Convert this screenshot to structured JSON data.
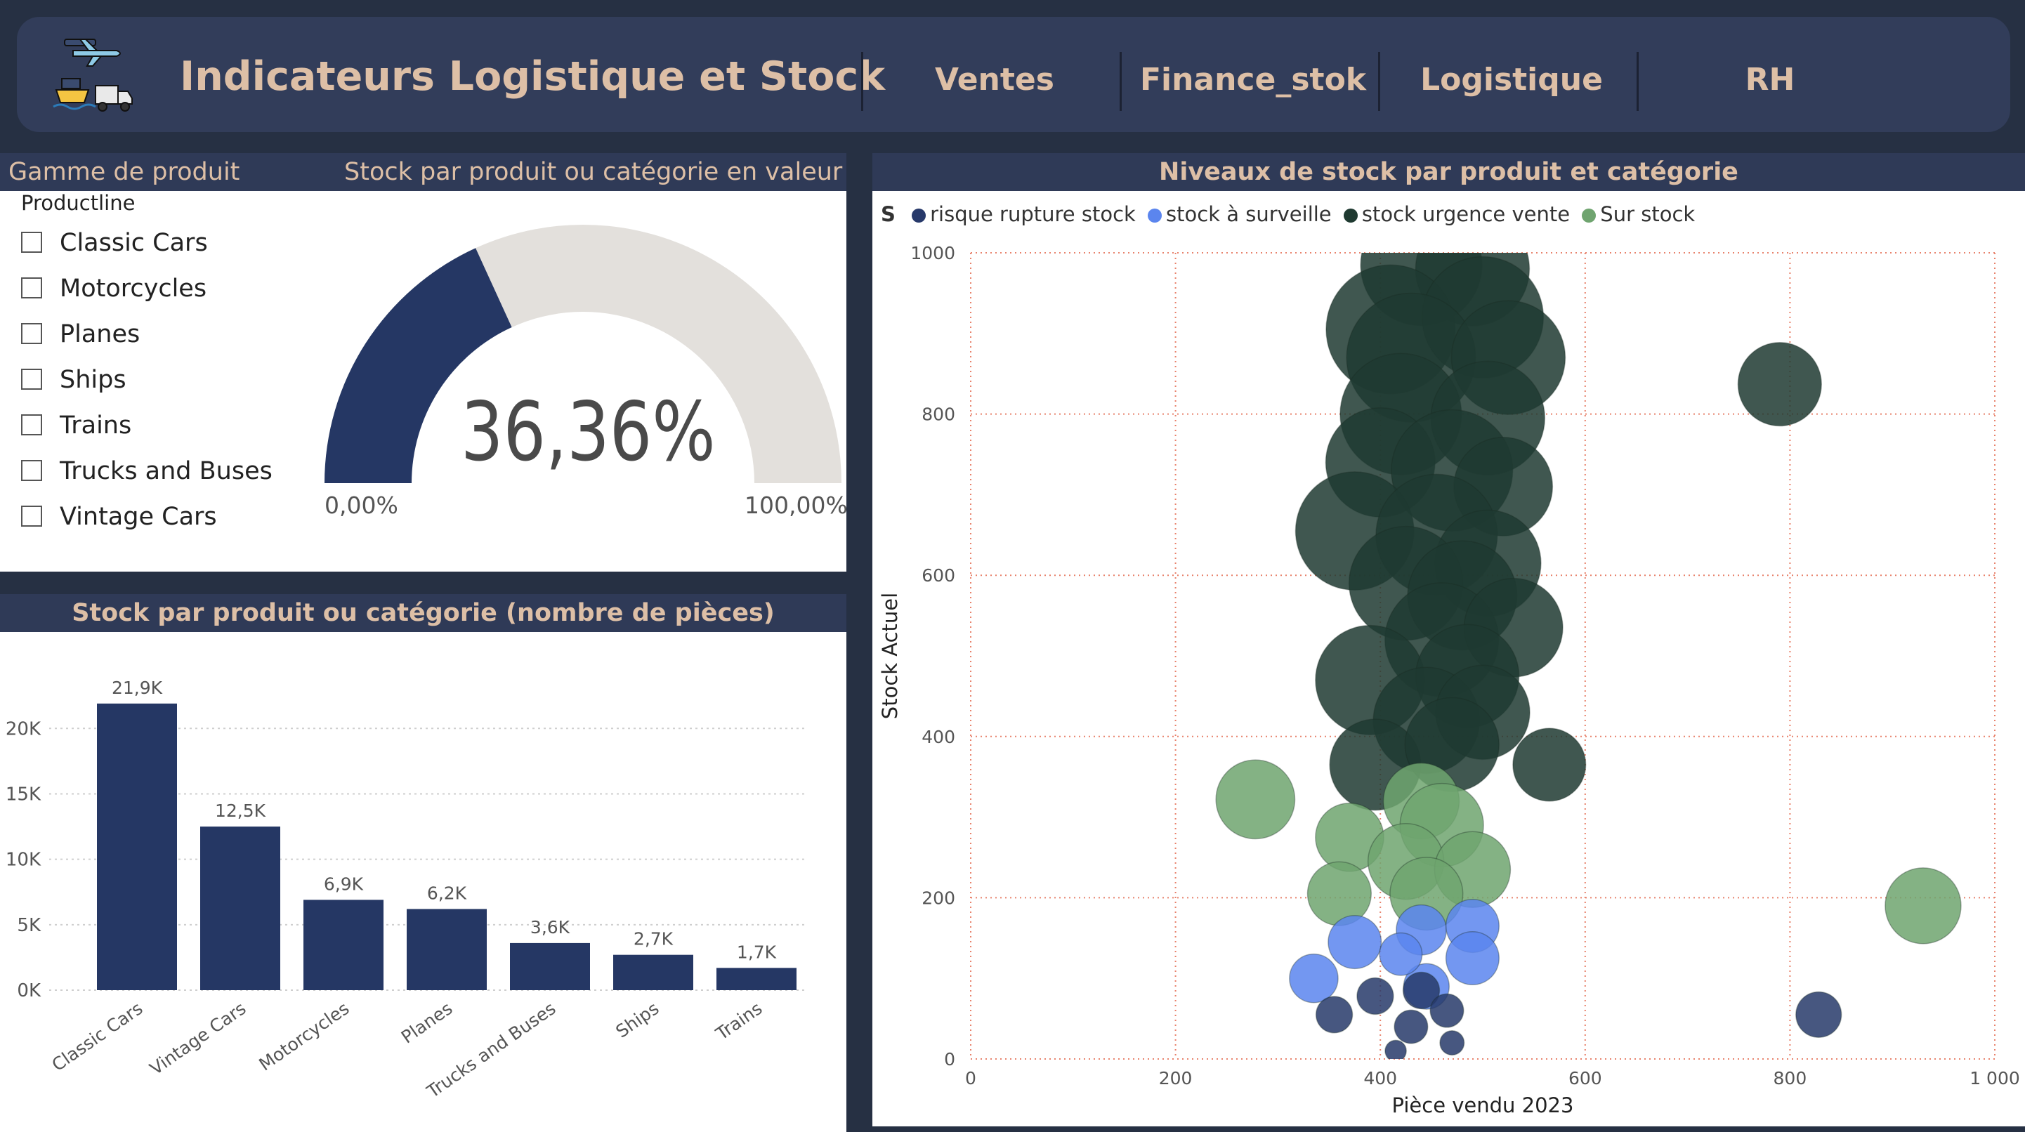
{
  "header": {
    "title": "Indicateurs Logistique et Stock",
    "nav": [
      "Ventes",
      "Finance_stok",
      "Logistique",
      "RH"
    ]
  },
  "slicer": {
    "heading": "Gamme de produit",
    "title": "Productline",
    "items": [
      "Classic Cars",
      "Motorcycles",
      "Planes",
      "Ships",
      "Trains",
      "Trucks and Buses",
      "Vintage Cars"
    ]
  },
  "gauge": {
    "heading": "Stock par produit ou catégorie en valeur",
    "value_label": "36,36%",
    "value": 36.36,
    "min_label": "0,00%",
    "max_label": "100,00%",
    "fill_color": "#253764",
    "track_color": "#e3e0dc"
  },
  "bar_chart": {
    "heading": "Stock par produit ou catégorie (nombre de pièces)"
  },
  "scatter": {
    "heading": "Niveaux de stock par produit et catégorie",
    "legend_title": "S",
    "legend": [
      {
        "label": "risque rupture stock",
        "color": "#27396a"
      },
      {
        "label": "stock à surveille",
        "color": "#5b85ee"
      },
      {
        "label": "stock urgence vente",
        "color": "#1f3a31"
      },
      {
        "label": "Sur stock",
        "color": "#6fa46f"
      }
    ]
  },
  "chart_data": [
    {
      "type": "bar",
      "title": "Stock par produit ou catégorie (nombre de pièces)",
      "categories": [
        "Classic Cars",
        "Vintage Cars",
        "Motorcycles",
        "Planes",
        "Trucks and Buses",
        "Ships",
        "Trains"
      ],
      "values": [
        21900,
        12500,
        6900,
        6200,
        3600,
        2700,
        1700
      ],
      "data_labels": [
        "21,9K",
        "12,5K",
        "6,9K",
        "6,2K",
        "3,6K",
        "2,7K",
        "1,7K"
      ],
      "ylim": [
        0,
        22000
      ],
      "yticks": [
        0,
        5000,
        10000,
        15000,
        20000
      ],
      "ytick_labels": [
        "0K",
        "5K",
        "10K",
        "15K",
        "20K"
      ],
      "grid": true,
      "color": "#253764"
    },
    {
      "type": "scatter",
      "title": "Niveaux de stock par produit et catégorie",
      "xlabel": "Pièce vendu 2023",
      "ylabel": "Stock Actuel",
      "xlim": [
        0,
        1000
      ],
      "ylim": [
        0,
        1000
      ],
      "xticks": [
        0,
        200,
        400,
        600,
        800,
        1000
      ],
      "xtick_labels": [
        "0",
        "200",
        "400",
        "600",
        "800",
        "1 000"
      ],
      "yticks": [
        0,
        200,
        400,
        600,
        800,
        1000
      ],
      "ytick_labels": [
        "0",
        "200",
        "400",
        "600",
        "800",
        "1000"
      ],
      "grid": true,
      "series": [
        {
          "name": "stock urgence vente",
          "points": [
            {
              "x": 440,
              "y": 985,
              "size": 80
            },
            {
              "x": 490,
              "y": 980,
              "size": 75
            },
            {
              "x": 410,
              "y": 905,
              "size": 85
            },
            {
              "x": 500,
              "y": 920,
              "size": 80
            },
            {
              "x": 430,
              "y": 870,
              "size": 85
            },
            {
              "x": 525,
              "y": 870,
              "size": 75
            },
            {
              "x": 420,
              "y": 800,
              "size": 80
            },
            {
              "x": 505,
              "y": 795,
              "size": 75
            },
            {
              "x": 400,
              "y": 740,
              "size": 72
            },
            {
              "x": 470,
              "y": 730,
              "size": 80
            },
            {
              "x": 520,
              "y": 710,
              "size": 65
            },
            {
              "x": 375,
              "y": 655,
              "size": 78
            },
            {
              "x": 455,
              "y": 650,
              "size": 80
            },
            {
              "x": 505,
              "y": 615,
              "size": 70
            },
            {
              "x": 425,
              "y": 590,
              "size": 75
            },
            {
              "x": 480,
              "y": 575,
              "size": 72
            },
            {
              "x": 460,
              "y": 520,
              "size": 75
            },
            {
              "x": 530,
              "y": 535,
              "size": 65
            },
            {
              "x": 390,
              "y": 470,
              "size": 72
            },
            {
              "x": 485,
              "y": 475,
              "size": 68
            },
            {
              "x": 445,
              "y": 420,
              "size": 70
            },
            {
              "x": 500,
              "y": 430,
              "size": 62
            },
            {
              "x": 395,
              "y": 365,
              "size": 60
            },
            {
              "x": 470,
              "y": 390,
              "size": 62
            },
            {
              "x": 565,
              "y": 365,
              "size": 48
            },
            {
              "x": 790,
              "y": 837,
              "size": 55
            }
          ]
        },
        {
          "name": "Sur stock",
          "points": [
            {
              "x": 278,
              "y": 322,
              "size": 52
            },
            {
              "x": 370,
              "y": 275,
              "size": 45
            },
            {
              "x": 440,
              "y": 320,
              "size": 50
            },
            {
              "x": 460,
              "y": 290,
              "size": 55
            },
            {
              "x": 425,
              "y": 245,
              "size": 50
            },
            {
              "x": 490,
              "y": 235,
              "size": 50
            },
            {
              "x": 360,
              "y": 205,
              "size": 42
            },
            {
              "x": 445,
              "y": 205,
              "size": 48
            },
            {
              "x": 930,
              "y": 190,
              "size": 50
            }
          ]
        },
        {
          "name": "stock à surveille",
          "points": [
            {
              "x": 375,
              "y": 145,
              "size": 35
            },
            {
              "x": 335,
              "y": 100,
              "size": 32
            },
            {
              "x": 440,
              "y": 160,
              "size": 33
            },
            {
              "x": 490,
              "y": 165,
              "size": 35
            },
            {
              "x": 490,
              "y": 125,
              "size": 35
            },
            {
              "x": 445,
              "y": 90,
              "size": 30
            },
            {
              "x": 420,
              "y": 130,
              "size": 28
            }
          ]
        },
        {
          "name": "risque rupture stock",
          "points": [
            {
              "x": 355,
              "y": 55,
              "size": 24
            },
            {
              "x": 395,
              "y": 78,
              "size": 24
            },
            {
              "x": 440,
              "y": 85,
              "size": 24
            },
            {
              "x": 465,
              "y": 60,
              "size": 22
            },
            {
              "x": 430,
              "y": 40,
              "size": 22
            },
            {
              "x": 470,
              "y": 20,
              "size": 16
            },
            {
              "x": 415,
              "y": 10,
              "size": 14
            },
            {
              "x": 828,
              "y": 55,
              "size": 30
            }
          ]
        }
      ]
    }
  ]
}
